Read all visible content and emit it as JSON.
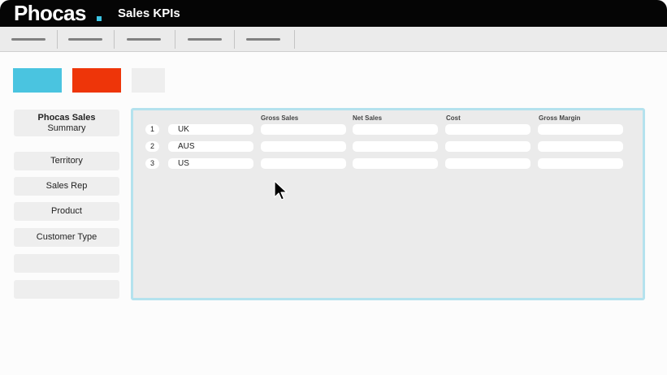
{
  "app": {
    "logo": "Phocas",
    "title": "Sales KPIs"
  },
  "menu": {
    "item_count": 5
  },
  "tiles": {
    "colors": [
      "#4ac4e0",
      "#ee3509",
      "#eeeeee"
    ]
  },
  "sidebar": {
    "items": [
      {
        "label": "Phocas Sales",
        "sublabel": "Summary"
      },
      {
        "label": "Territory"
      },
      {
        "label": "Sales Rep"
      },
      {
        "label": "Product"
      },
      {
        "label": "Customer Type"
      },
      {
        "label": ""
      },
      {
        "label": ""
      }
    ]
  },
  "grid": {
    "columns": [
      "Gross Sales",
      "Net Sales",
      "Cost",
      "Gross Margin"
    ],
    "rows": [
      {
        "num": "1",
        "name": "UK"
      },
      {
        "num": "2",
        "name": "AUS"
      },
      {
        "num": "3",
        "name": "US"
      }
    ]
  },
  "colors": {
    "accent": "#4ac4e0",
    "alert": "#ee3509",
    "panel_border": "#b4e2ee",
    "topbar": "#050505"
  }
}
